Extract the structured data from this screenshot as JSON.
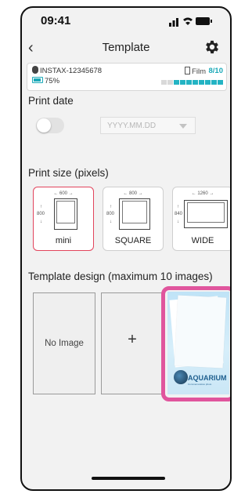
{
  "status_bar": {
    "time": "09:41"
  },
  "nav": {
    "title": "Template"
  },
  "device": {
    "model": "INSTAX-12345678",
    "battery": "75%",
    "film_label": "Film",
    "film_count": "8/10",
    "film_remaining_fraction": 0.8
  },
  "print_date": {
    "label": "Print date",
    "toggle_on": false,
    "placeholder": "YYYY.MM.DD"
  },
  "print_size": {
    "label": "Print size (pixels)",
    "options": [
      {
        "name": "mini",
        "width": "600",
        "height": "800",
        "selected": true
      },
      {
        "name": "SQUARE",
        "width": "800",
        "height": "800",
        "selected": false
      },
      {
        "name": "WIDE",
        "width": "1260",
        "height": "840",
        "selected": false
      }
    ]
  },
  "template_design": {
    "label": "Template design (maximum 10 images)",
    "empty_label": "No Image",
    "add_label": "+",
    "image_title": "AQUARIUM",
    "image_subtitle": "Commemorative photo"
  },
  "colors": {
    "accent": "#1aa9b8",
    "selected_border": "#e2445c",
    "highlight": "#e0559d"
  }
}
